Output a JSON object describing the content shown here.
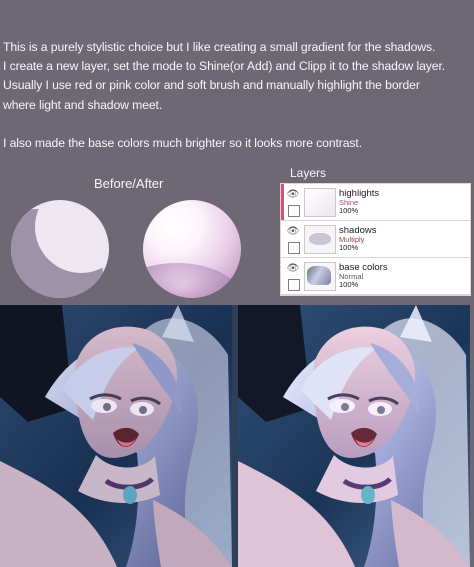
{
  "tutorial": {
    "line_1": "This is a purely stylistic choice but I like creating a small gradient for the shadows.",
    "line_2": "I create a new layer, set the mode to Shine(or Add) and Clipp it to the shadow layer.",
    "line_3": "Usually I use red or pink color and soft brush and manually highlight the border",
    "line_4": "where light and shadow meet.",
    "line_5": "I also made the base colors much brighter so it looks more contrast."
  },
  "comparison": {
    "title": "Before/After"
  },
  "layers_panel": {
    "title": "Layers",
    "rows": [
      {
        "name": "highlights",
        "mode": "Shine",
        "opacity": "100%"
      },
      {
        "name": "shadows",
        "mode": "Multiply",
        "opacity": "100%"
      },
      {
        "name": "base colors",
        "mode": "Normal",
        "opacity": "100%"
      }
    ]
  },
  "icons": {
    "visibility": "eye-icon",
    "checkbox": "checkbox-icon"
  },
  "colors": {
    "background": "#6d6873",
    "text": "#f7f6f8",
    "clip_marker": "#d34f7a",
    "shine_mode": "#9d4f8d",
    "multiply_mode": "#8c4d4d"
  }
}
